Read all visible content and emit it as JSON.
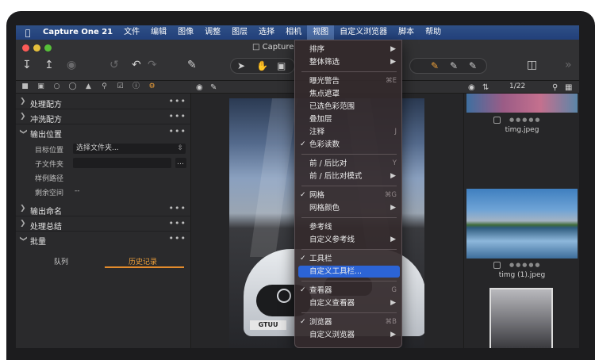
{
  "menubar": {
    "app": "Capture One 21",
    "items": [
      "文件",
      "编辑",
      "图像",
      "调整",
      "图层",
      "选择",
      "相机",
      "视图",
      "自定义浏览器",
      "脚本",
      "帮助"
    ],
    "active": "视图"
  },
  "window": {
    "title": "Capture"
  },
  "left_panel": {
    "sections": {
      "process_recipes": "处理配方",
      "develop_recipes": "冲洗配方",
      "output_location": "输出位置",
      "output_naming": "输出命名",
      "process_summary": "处理总结",
      "batch": "批量"
    },
    "fields": {
      "target_label": "目标位置",
      "target_value": "选择文件夹...",
      "subfolder_label": "子文件夹",
      "sample_path_label": "样例路径",
      "free_space_label": "剩余空间",
      "free_space_value": "--"
    },
    "batch_tabs": {
      "queue": "队列",
      "history": "历史记录"
    }
  },
  "browser": {
    "counter": "1/22",
    "thumbs": [
      {
        "name": "timg.jpeg"
      },
      {
        "name": "timg (1).jpeg"
      }
    ]
  },
  "photo": {
    "plate": "GTUU"
  },
  "menu": {
    "items": [
      {
        "label": "排序",
        "arrow": "▶"
      },
      {
        "label": "整体筛选",
        "arrow": "▶"
      },
      {
        "label": "曝光警告",
        "shortcut": "⌘E"
      },
      {
        "label": "焦点遮罩"
      },
      {
        "label": "已选色彩范围"
      },
      {
        "label": "叠加层"
      },
      {
        "label": "注释",
        "shortcut": "J"
      },
      {
        "label": "色彩读数",
        "check": "✓"
      },
      {
        "label": "前 / 后比对",
        "shortcut": "Y"
      },
      {
        "label": "前 / 后比对模式",
        "arrow": "▶"
      },
      {
        "label": "网格",
        "check": "✓",
        "shortcut": "⌘G"
      },
      {
        "label": "网格颜色",
        "arrow": "▶"
      },
      {
        "label": "参考线"
      },
      {
        "label": "自定义参考线",
        "arrow": "▶"
      },
      {
        "label": "工具栏",
        "check": "✓"
      },
      {
        "label": "自定义工具栏..."
      },
      {
        "label": "查看器",
        "check": "✓",
        "shortcut": "G"
      },
      {
        "label": "自定义查看器",
        "arrow": "▶"
      },
      {
        "label": "浏览器",
        "check": "✓",
        "shortcut": "⌘B"
      },
      {
        "label": "自定义浏览器",
        "arrow": "▶"
      }
    ]
  }
}
